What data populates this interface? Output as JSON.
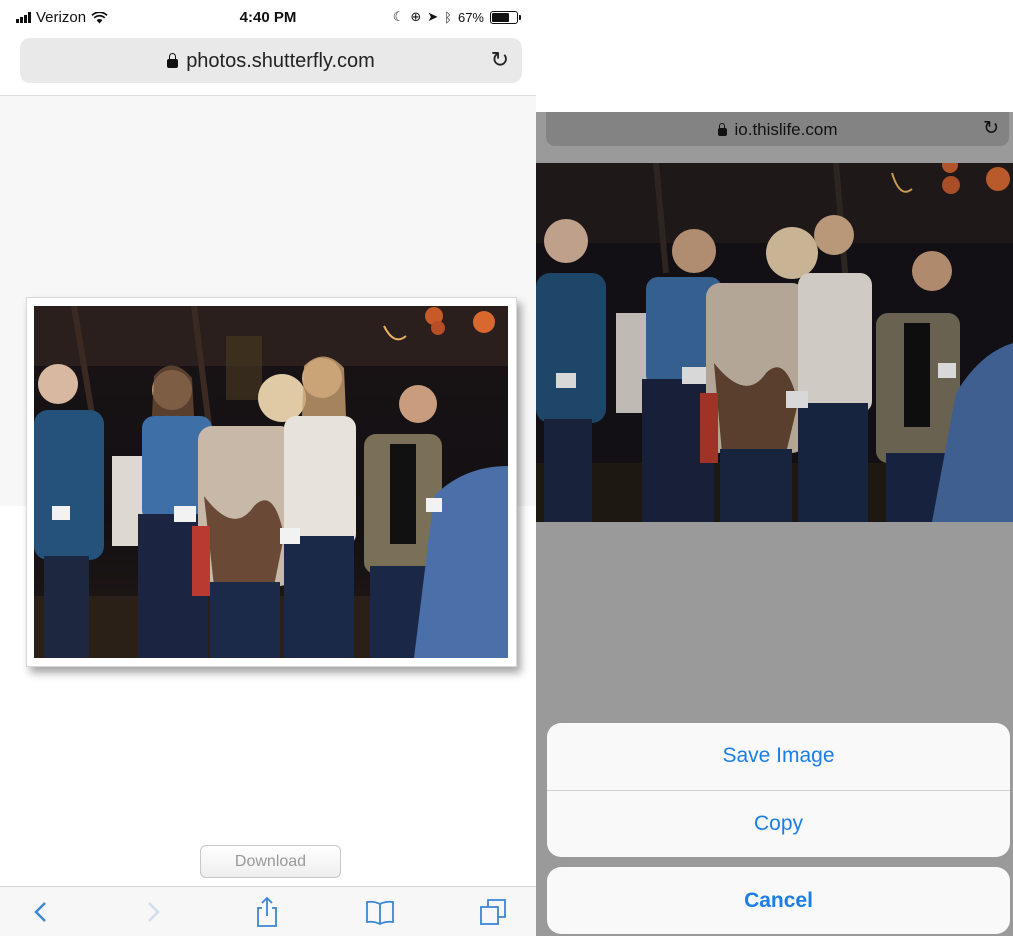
{
  "left_screen": {
    "status": {
      "carrier": "Verizon",
      "time": "4:40 PM",
      "battery": "67%"
    },
    "address_bar": {
      "url": "photos.shutterfly.com"
    },
    "download_label": "Download",
    "toolbar_icons": [
      "back-icon",
      "forward-icon",
      "share-icon",
      "bookmarks-icon",
      "tabs-icon"
    ]
  },
  "right_screen": {
    "address_bar": {
      "url": "io.thislife.com"
    },
    "action_sheet": {
      "save_image": "Save Image",
      "copy": "Copy",
      "cancel": "Cancel"
    }
  },
  "colors": {
    "ios_blue": "#1a7ee6",
    "dim_overlay": "#9a9a9a"
  }
}
